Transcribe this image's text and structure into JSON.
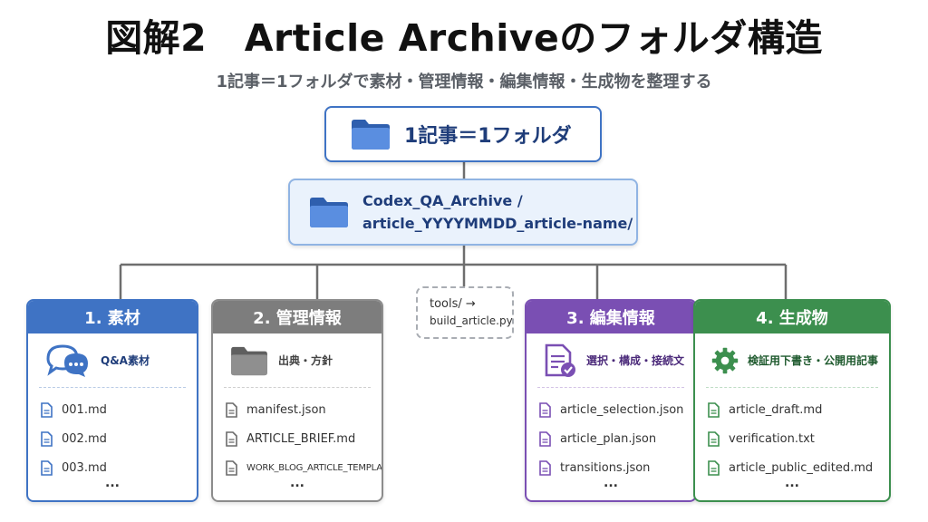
{
  "title": "図解2　Article Archiveのフォルダ構造",
  "subtitle": "1記事＝1フォルダで素材・管理情報・編集情報・生成物を整理する",
  "root": {
    "label": "1記事＝1フォルダ",
    "icon": "folder-icon"
  },
  "path": {
    "line1": "Codex_QA_Archive /",
    "line2": "article_YYYYMMDD_article-name/",
    "icon": "folder-icon"
  },
  "tools": {
    "line1": "tools/ →",
    "line2": "build_article.py"
  },
  "cards": [
    {
      "header": "1. 素材",
      "sublabel": "Q&A素材",
      "icon": "chat-bubbles-icon",
      "color": "#3f73c4",
      "files": [
        "001.md",
        "002.md",
        "003.md"
      ],
      "more": "..."
    },
    {
      "header": "2. 管理情報",
      "sublabel": "出典・方針",
      "icon": "folder-icon",
      "color": "#7d7d7d",
      "files": [
        "manifest.json",
        "ARTICLE_BRIEF.md",
        "WORK_BLOG_ARTICLE_TEMPLATE.md"
      ],
      "more": "..."
    },
    {
      "header": "3. 編集情報",
      "sublabel": "選択・構成・接続文",
      "icon": "document-check-icon",
      "color": "#7a4fb3",
      "files": [
        "article_selection.json",
        "article_plan.json",
        "transitions.json"
      ],
      "more": "..."
    },
    {
      "header": "4. 生成物",
      "sublabel": "検証用下書き・公開用記事",
      "icon": "gear-icon",
      "color": "#3c8f4e",
      "files": [
        "article_draft.md",
        "verification.txt",
        "article_public_edited.md"
      ],
      "more": "..."
    }
  ]
}
